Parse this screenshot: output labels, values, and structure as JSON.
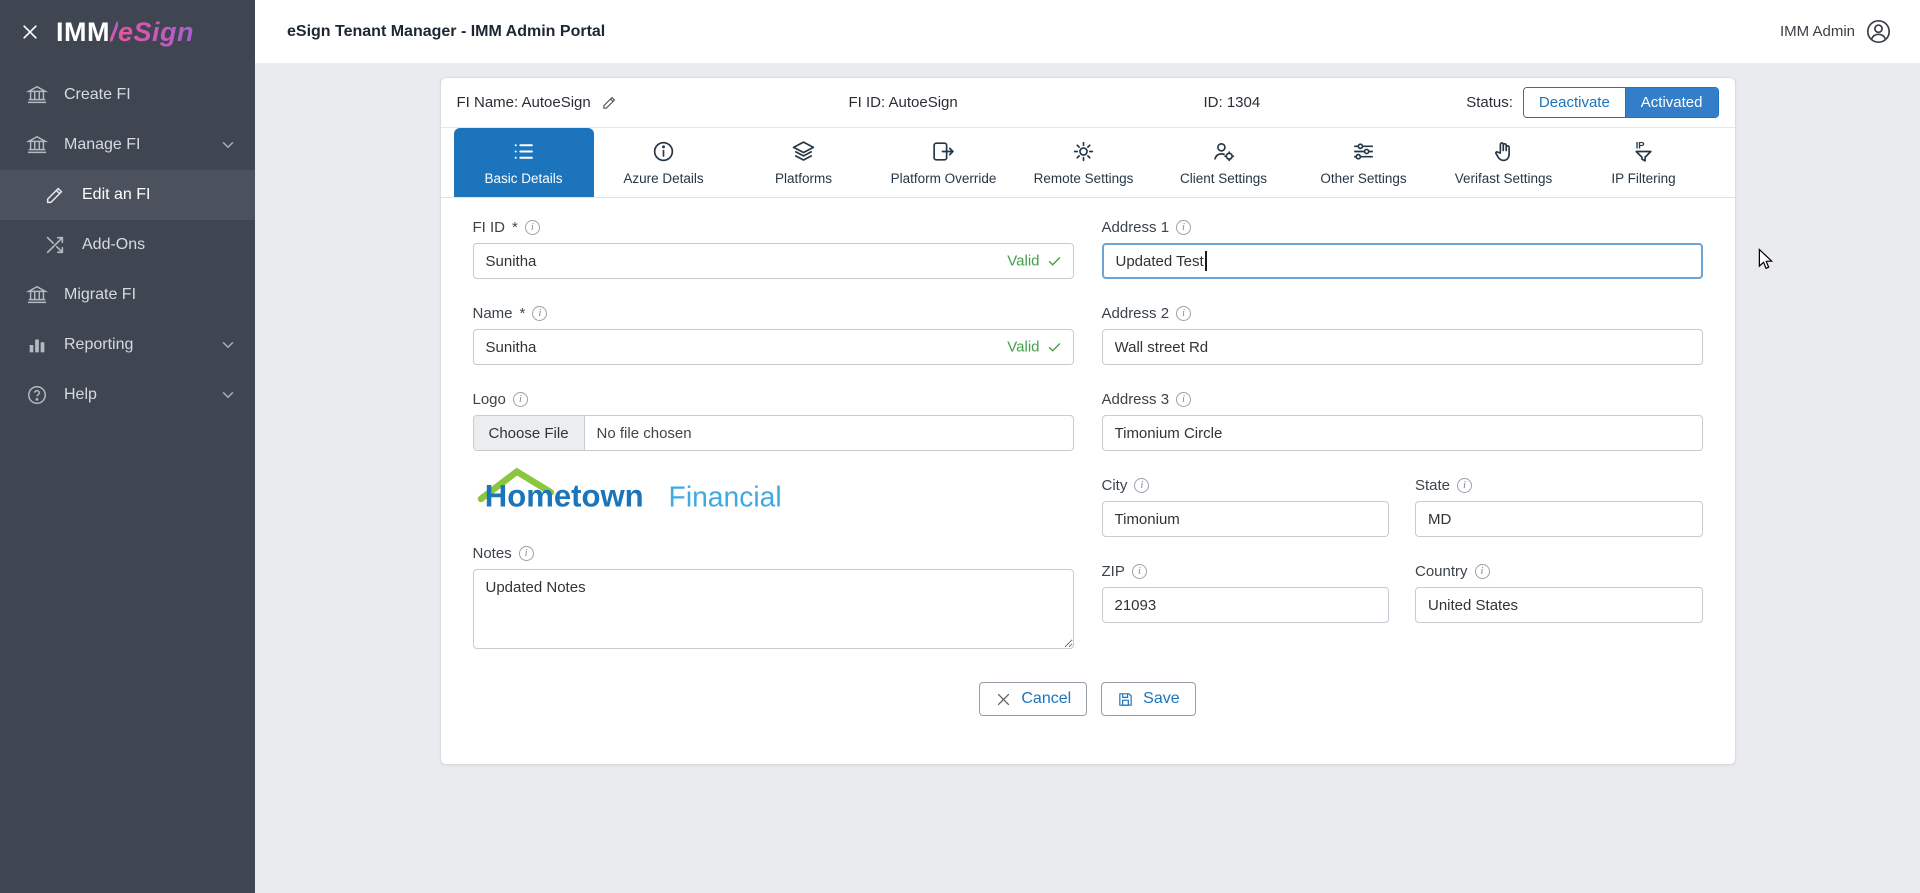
{
  "brand": {
    "imm": "IMM",
    "slash": "/",
    "esign": "eSign"
  },
  "topbar": {
    "title": "eSign Tenant Manager - IMM Admin Portal",
    "user": "IMM Admin"
  },
  "sidebar": {
    "items": [
      {
        "label": "Create FI"
      },
      {
        "label": "Manage FI"
      },
      {
        "label": "Edit an FI"
      },
      {
        "label": "Add-Ons"
      },
      {
        "label": "Migrate FI"
      },
      {
        "label": "Reporting"
      },
      {
        "label": "Help"
      }
    ]
  },
  "fi_header": {
    "fi_name": "FI Name: AutoeSign",
    "fi_id": "FI ID: AutoeSign",
    "id": "ID: 1304",
    "status_label": "Status:",
    "deactivate": "Deactivate",
    "activated": "Activated"
  },
  "tabs": [
    {
      "label": "Basic Details"
    },
    {
      "label": "Azure Details"
    },
    {
      "label": "Platforms"
    },
    {
      "label": "Platform Override"
    },
    {
      "label": "Remote Settings"
    },
    {
      "label": "Client Settings"
    },
    {
      "label": "Other Settings"
    },
    {
      "label": "Verifast Settings"
    },
    {
      "label": "IP Filtering"
    }
  ],
  "form": {
    "fi_id": {
      "label": "FI ID",
      "required": "*",
      "value": "Sunitha",
      "valid": "Valid"
    },
    "name": {
      "label": "Name",
      "required": "*",
      "value": "Sunitha",
      "valid": "Valid"
    },
    "logo": {
      "label": "Logo",
      "choose_file": "Choose File",
      "no_file": "No file chosen"
    },
    "logo_preview": {
      "word1": "Hometown",
      "word2": "Financial"
    },
    "notes": {
      "label": "Notes",
      "value": "Updated Notes"
    },
    "address1": {
      "label": "Address 1",
      "value": "Updated Test"
    },
    "address2": {
      "label": "Address 2",
      "value": "Wall street Rd"
    },
    "address3": {
      "label": "Address 3",
      "value": "Timonium Circle"
    },
    "city": {
      "label": "City",
      "value": "Timonium"
    },
    "state": {
      "label": "State",
      "value": "MD"
    },
    "zip": {
      "label": "ZIP",
      "value": "21093"
    },
    "country": {
      "label": "Country",
      "value": "United States"
    }
  },
  "actions": {
    "cancel": "Cancel",
    "save": "Save"
  },
  "colors": {
    "primary_blue": "#1b74bc",
    "activated_blue": "#337ec9",
    "valid_green": "#43a047",
    "brand_pink": "#e8559f",
    "brand_purple": "#a95fd3",
    "sidebar_bg": "#3f4651",
    "sidebar_active_bg": "#4c525d",
    "page_bg": "#e9ebee",
    "logo_blue": "#1b75bb",
    "logo_light_blue": "#3fa9e1",
    "logo_green": "#8cc63e"
  }
}
